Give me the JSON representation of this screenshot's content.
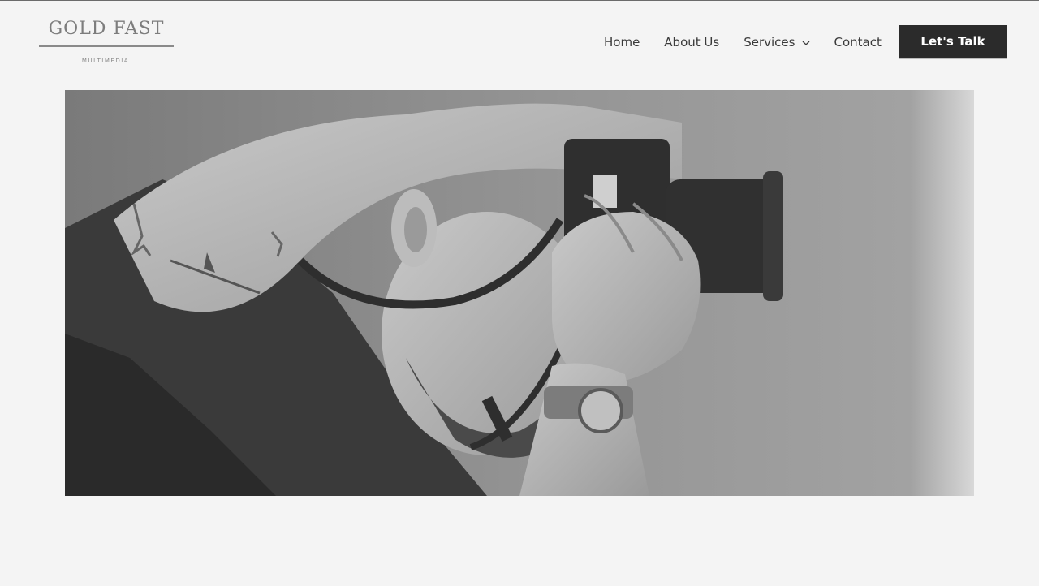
{
  "header": {
    "logo": {
      "title": "GOLD FAST",
      "subtitle": "MULTIMEDIA"
    },
    "nav": {
      "items": [
        {
          "label": "Home"
        },
        {
          "label": "About Us"
        },
        {
          "label": "Services",
          "has_dropdown": true
        },
        {
          "label": "Contact"
        }
      ]
    },
    "cta_label": "Let's Talk"
  },
  "hero": {
    "image_subject": "photographer-with-camera",
    "style": "grayscale"
  },
  "colors": {
    "background": "#f4f4f4",
    "cta_bg": "#2b2b2b",
    "nav_text": "#3a3a3a",
    "logo_gray": "#7d7d7d"
  }
}
